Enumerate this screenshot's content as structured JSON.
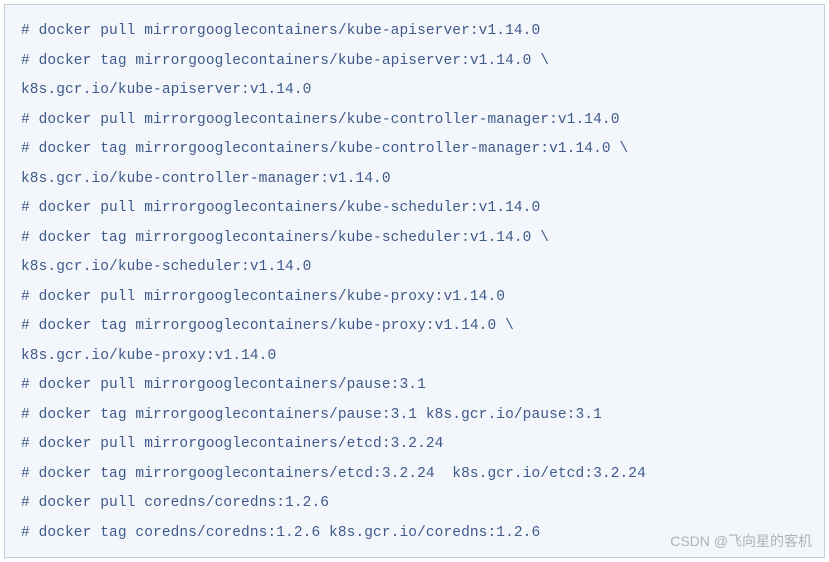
{
  "code": {
    "lines": [
      "# docker pull mirrorgooglecontainers/kube-apiserver:v1.14.0",
      "# docker tag mirrorgooglecontainers/kube-apiserver:v1.14.0 \\",
      "k8s.gcr.io/kube-apiserver:v1.14.0",
      "# docker pull mirrorgooglecontainers/kube-controller-manager:v1.14.0",
      "# docker tag mirrorgooglecontainers/kube-controller-manager:v1.14.0 \\",
      "k8s.gcr.io/kube-controller-manager:v1.14.0",
      "# docker pull mirrorgooglecontainers/kube-scheduler:v1.14.0",
      "# docker tag mirrorgooglecontainers/kube-scheduler:v1.14.0 \\",
      "k8s.gcr.io/kube-scheduler:v1.14.0",
      "# docker pull mirrorgooglecontainers/kube-proxy:v1.14.0",
      "# docker tag mirrorgooglecontainers/kube-proxy:v1.14.0 \\",
      "k8s.gcr.io/kube-proxy:v1.14.0",
      "# docker pull mirrorgooglecontainers/pause:3.1",
      "# docker tag mirrorgooglecontainers/pause:3.1 k8s.gcr.io/pause:3.1",
      "# docker pull mirrorgooglecontainers/etcd:3.2.24",
      "# docker tag mirrorgooglecontainers/etcd:3.2.24  k8s.gcr.io/etcd:3.2.24",
      "# docker pull coredns/coredns:1.2.6",
      "# docker tag coredns/coredns:1.2.6 k8s.gcr.io/coredns:1.2.6"
    ]
  },
  "watermark": "CSDN @飞向星的客机"
}
